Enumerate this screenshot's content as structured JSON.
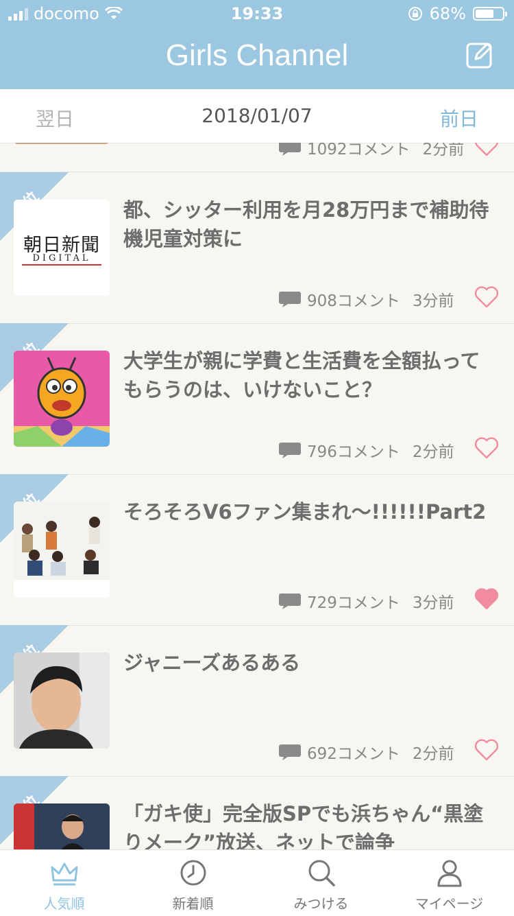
{
  "status_bar": {
    "carrier": "docomo",
    "time": "19:33",
    "battery": "68%",
    "battery_level": 0.68
  },
  "header": {
    "title": "Girls Channel"
  },
  "date_nav": {
    "next_label": "翌日",
    "date": "2018/01/07",
    "prev_label": "前日"
  },
  "partial_item": {
    "comments": "1092コメント",
    "ago": "2分前"
  },
  "items": [
    {
      "rank": "4位",
      "title": "都、シッター利用を月28万円まで補助待機児童対策に",
      "comments": "908コメント",
      "ago": "3分前",
      "liked": false,
      "thumb_text": "朝日新聞",
      "thumb_sub": "DIGITAL"
    },
    {
      "rank": "5位",
      "title": "大学生が親に学費と生活費を全額払ってもらうのは、いけないこと？",
      "comments": "796コメント",
      "ago": "2分前",
      "liked": false
    },
    {
      "rank": "6位",
      "title": "そろそろV6ファン集まれ〜!!!!!!Part2",
      "comments": "729コメント",
      "ago": "3分前",
      "liked": true
    },
    {
      "rank": "7位",
      "title": "ジャニーズあるある",
      "comments": "692コメント",
      "ago": "2分前",
      "liked": false
    },
    {
      "rank": "8位",
      "title": "「ガキ使」完全版SPでも浜ちゃん“黒塗りメーク”放送、ネットで論争",
      "comments": "",
      "ago": "",
      "liked": false
    }
  ],
  "tabs": [
    {
      "label": "人気順",
      "icon": "crown-icon",
      "active": true
    },
    {
      "label": "新着順",
      "icon": "clock-icon",
      "active": false
    },
    {
      "label": "みつける",
      "icon": "search-icon",
      "active": false
    },
    {
      "label": "マイページ",
      "icon": "user-icon",
      "active": false
    }
  ],
  "colors": {
    "header": "#9cc7e0",
    "accent": "#7fb8d9",
    "heart": "#f08ba0",
    "ribbon": "#a9cce2"
  }
}
